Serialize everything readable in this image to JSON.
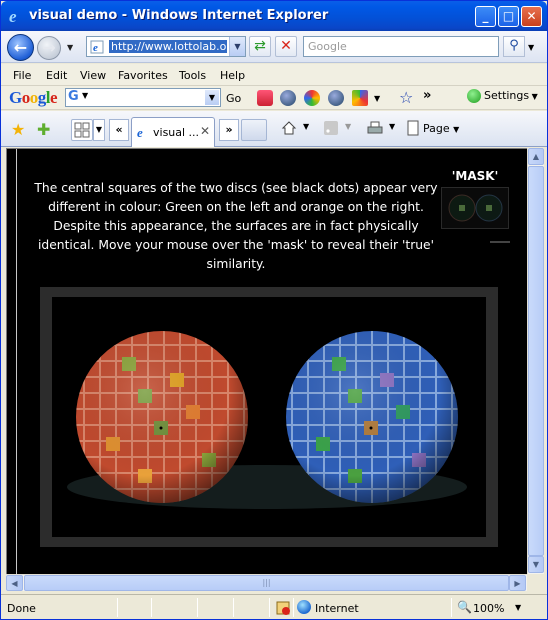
{
  "window": {
    "title": "visual demo - Windows Internet Explorer"
  },
  "title_buttons": {
    "minimize": "_",
    "maximize": "□",
    "close": "✕"
  },
  "address": {
    "url": "http://www.lottolab.org",
    "search_placeholder": "Google"
  },
  "menu": {
    "items": [
      "File",
      "Edit",
      "View",
      "Favorites",
      "Tools",
      "Help"
    ]
  },
  "google_toolbar": {
    "logo": "Google",
    "go_label": "Go",
    "settings_label": "Settings",
    "more": "»"
  },
  "tabs": {
    "active_label": "visual ...",
    "scroll_left": "«",
    "scroll_right": "»"
  },
  "commands": {
    "page_label": "Page"
  },
  "content": {
    "description": "The central squares of the two discs (see black dots) appear very different in colour: Green on the left and orange on the right. Despite this appearance, the surfaces are in fact physically identical. Move your mouse over the 'mask' to reveal their 'true' similarity.",
    "mask_title": "'MASK'"
  },
  "status": {
    "text": "Done",
    "zone": "Internet",
    "zoom": "100%"
  },
  "colors": {
    "titlebar": "#0058e6",
    "content_bg": "#000000",
    "left_sphere_tint": "#c8503a",
    "right_sphere_tint": "#3a6ac8"
  },
  "icons": [
    "ie-icon",
    "back-arrow-icon",
    "forward-arrow-icon",
    "refresh-icon",
    "stop-icon",
    "search-icon",
    "favorites-star-icon",
    "add-favorites-icon",
    "quick-tabs-icon",
    "home-icon",
    "feeds-icon",
    "print-icon",
    "page-icon",
    "globe-icon",
    "zoom-icon"
  ]
}
